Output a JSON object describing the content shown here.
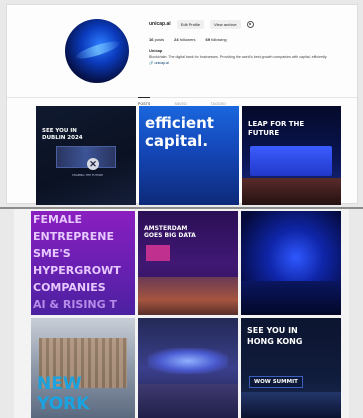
{
  "profile": {
    "username": "unicap.ai",
    "edit_profile": "Edit Profile",
    "view_archive": "View archive",
    "posts_count": "16",
    "posts_label": "posts",
    "followers_count": "24",
    "followers_label": "followers",
    "following_count": "69",
    "following_label": "following",
    "name": "Unicap",
    "bio": "Blockchain: The digital bank for businesses. Providing the world's best growth companies with capital, efficiently.",
    "link": "🔗 unicap.ai"
  },
  "tabs": [
    {
      "label": "POSTS"
    },
    {
      "label": "SAVED"
    },
    {
      "label": "TAGGED"
    }
  ],
  "posts": {
    "p1": {
      "line1": "SEE YOU IN",
      "line2": "DUBLIN 2024",
      "small": "SHAPING THE FUTURE"
    },
    "p2": {
      "line1": "efficient",
      "line2": "capital."
    },
    "p3": {
      "line1": "LEAP FOR THE",
      "line2": "FUTURE"
    },
    "p4": {
      "lines": [
        "FEMALE",
        "ENTREPRENE",
        "SME'S",
        "HYPERGROWT",
        "COMPANIES",
        "AI & RISING T"
      ]
    },
    "p5": {
      "line1": "AMSTERDAM",
      "line2": "GOES BIG DATA"
    },
    "p7": {
      "line1": "NEW",
      "line2": "YORK"
    },
    "p9": {
      "line1": "SEE YOU IN",
      "line2": "HONG KONG",
      "badge": "WOW SUMMIT"
    }
  },
  "colors": {
    "accent_blue": "#1a66dd",
    "purple": "#8a1fbf",
    "bg": "#e9e9e9"
  }
}
